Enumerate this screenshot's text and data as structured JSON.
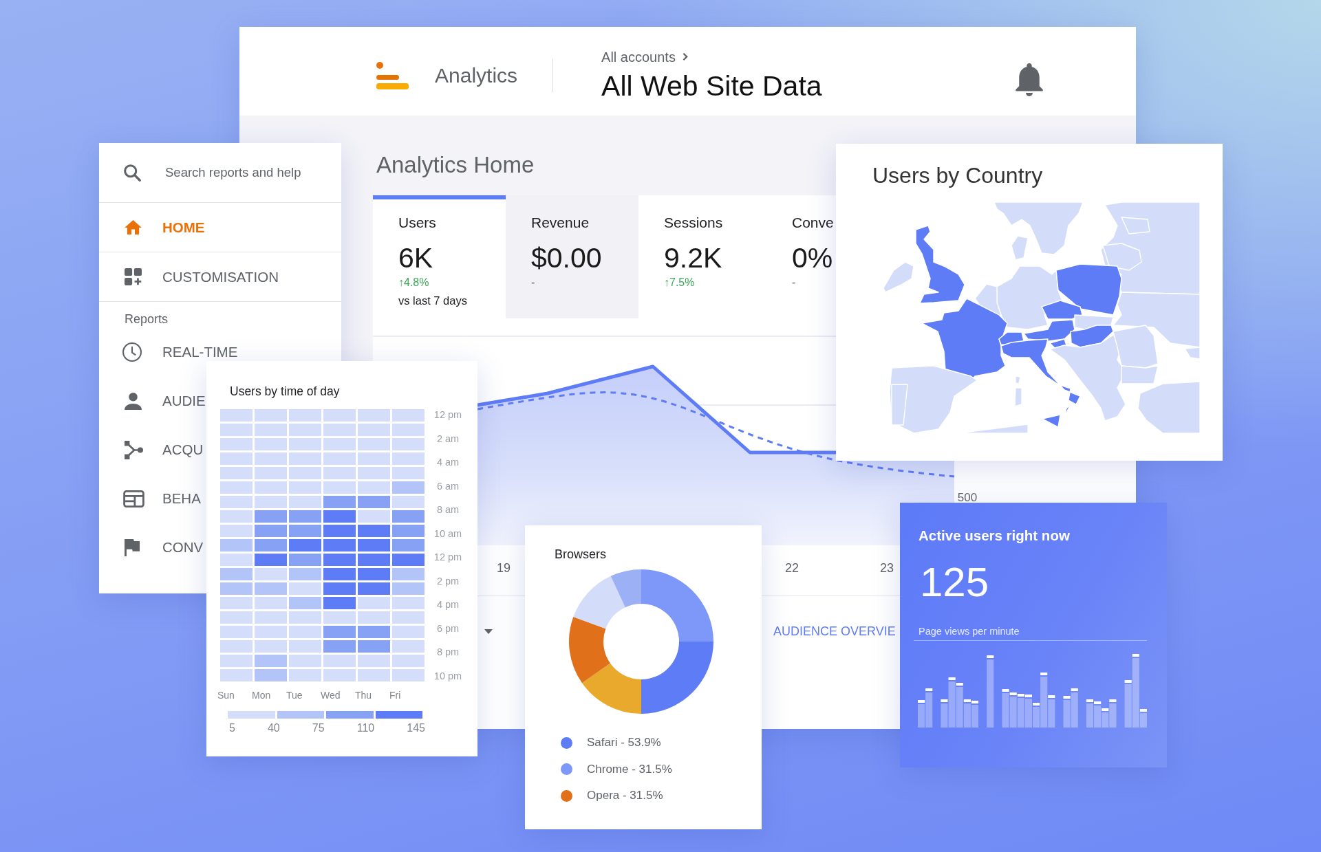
{
  "header": {
    "app_name": "Analytics",
    "breadcrumb": "All accounts",
    "view_title": "All Web Site Data"
  },
  "sidebar": {
    "search": {
      "placeholder": "Search reports and help"
    },
    "items": [
      {
        "label": "HOME",
        "selected": true
      },
      {
        "label": "CUSTOMISATION",
        "selected": false
      }
    ],
    "reports": {
      "title": "Reports",
      "items": [
        {
          "label": "REAL-TIME",
          "selected": false
        },
        {
          "label": "AUDIE",
          "selected": false
        },
        {
          "label": "ACQU",
          "selected": false
        },
        {
          "label": "BEHA",
          "selected": false
        },
        {
          "label": "CONV",
          "selected": false
        }
      ]
    }
  },
  "page_title": "Analytics Home",
  "metrics": [
    {
      "label": "Users",
      "value": "6K",
      "change": "↑4.8%",
      "rising": true,
      "note": "vs last 7 days",
      "selected": true,
      "shaded": false
    },
    {
      "label": "Revenue",
      "value": "$0.00",
      "change": "-",
      "rising": false,
      "selected": false,
      "shaded": true
    },
    {
      "label": "Sessions",
      "value": "9.2K",
      "change": "↑7.5%",
      "rising": true,
      "selected": false,
      "shaded": false
    },
    {
      "label": "Conve",
      "value": "0%",
      "change": "-",
      "rising": false,
      "selected": false,
      "shaded": false
    }
  ],
  "chart": {
    "x_labels": [
      "19",
      "22",
      "23"
    ],
    "y_label": "500"
  },
  "footer": {
    "link": "AUDIENCE OVERVIE"
  },
  "heatmap": {
    "title": "Users by time of day",
    "rows": [
      {
        "cells": [
          {
            "color": "#d4defb"
          },
          {
            "color": "#d4defb"
          },
          {
            "color": "#d4defb"
          },
          {
            "color": "#d4defb"
          },
          {
            "color": "#d4defb"
          },
          {
            "color": "#d4defb"
          }
        ]
      },
      {
        "cells": [
          {
            "color": "#d4defb"
          },
          {
            "color": "#d4defb"
          },
          {
            "color": "#d4defb"
          },
          {
            "color": "#d4defb"
          },
          {
            "color": "#d4defb"
          },
          {
            "color": "#d4defb"
          }
        ]
      },
      {
        "cells": [
          {
            "color": "#d4defb"
          },
          {
            "color": "#d4defb"
          },
          {
            "color": "#d4defb"
          },
          {
            "color": "#d4defb"
          },
          {
            "color": "#d4defb"
          },
          {
            "color": "#d4defb"
          }
        ]
      },
      {
        "cells": [
          {
            "color": "#d4defb"
          },
          {
            "color": "#d4defb"
          },
          {
            "color": "#d4defb"
          },
          {
            "color": "#d4defb"
          },
          {
            "color": "#d4defb"
          },
          {
            "color": "#d4defb"
          }
        ]
      },
      {
        "cells": [
          {
            "color": "#d4defb"
          },
          {
            "color": "#d4defb"
          },
          {
            "color": "#d4defb"
          },
          {
            "color": "#d4defb"
          },
          {
            "color": "#d4defb"
          },
          {
            "color": "#d4defb"
          }
        ]
      },
      {
        "cells": [
          {
            "color": "#d4defb"
          },
          {
            "color": "#d4defb"
          },
          {
            "color": "#d4defb"
          },
          {
            "color": "#d4defb"
          },
          {
            "color": "#d4defb"
          },
          {
            "color": "#b3c4f9"
          }
        ]
      },
      {
        "cells": [
          {
            "color": "#d4defb"
          },
          {
            "color": "#d4defb"
          },
          {
            "color": "#d4defb"
          },
          {
            "color": "#87a1f5"
          },
          {
            "color": "#87a1f5"
          },
          {
            "color": "#d4defb"
          }
        ]
      },
      {
        "cells": [
          {
            "color": "#d4defb"
          },
          {
            "color": "#87a1f5"
          },
          {
            "color": "#87a1f5"
          },
          {
            "color": "#5f7cf7"
          },
          {
            "color": "#d4defb"
          },
          {
            "color": "#87a1f5"
          }
        ]
      },
      {
        "cells": [
          {
            "color": "#d4defb"
          },
          {
            "color": "#87a1f5"
          },
          {
            "color": "#87a1f5"
          },
          {
            "color": "#5f7cf7"
          },
          {
            "color": "#5f7cf7"
          },
          {
            "color": "#87a1f5"
          }
        ]
      },
      {
        "cells": [
          {
            "color": "#b3c4f9"
          },
          {
            "color": "#87a1f5"
          },
          {
            "color": "#5f7cf7"
          },
          {
            "color": "#5f7cf7"
          },
          {
            "color": "#5f7cf7"
          },
          {
            "color": "#87a1f5"
          }
        ]
      },
      {
        "cells": [
          {
            "color": "#d4defb"
          },
          {
            "color": "#5f7cf7"
          },
          {
            "color": "#87a1f5"
          },
          {
            "color": "#5f7cf7"
          },
          {
            "color": "#5f7cf7"
          },
          {
            "color": "#5f7cf7"
          }
        ]
      },
      {
        "cells": [
          {
            "color": "#b3c4f9"
          },
          {
            "color": "#d4defb"
          },
          {
            "color": "#b3c4f9"
          },
          {
            "color": "#5f7cf7"
          },
          {
            "color": "#5f7cf7"
          },
          {
            "color": "#b3c4f9"
          }
        ]
      },
      {
        "cells": [
          {
            "color": "#b3c4f9"
          },
          {
            "color": "#b3c4f9"
          },
          {
            "color": "#d4defb"
          },
          {
            "color": "#5f7cf7"
          },
          {
            "color": "#5f7cf7"
          },
          {
            "color": "#b3c4f9"
          }
        ]
      },
      {
        "cells": [
          {
            "color": "#d4defb"
          },
          {
            "color": "#d4defb"
          },
          {
            "color": "#b3c4f9"
          },
          {
            "color": "#5f7cf7"
          },
          {
            "color": "#d4defb"
          },
          {
            "color": "#d4defb"
          }
        ]
      },
      {
        "cells": [
          {
            "color": "#d4defb"
          },
          {
            "color": "#d4defb"
          },
          {
            "color": "#d4defb"
          },
          {
            "color": "#d4defb"
          },
          {
            "color": "#d4defb"
          },
          {
            "color": "#d4defb"
          }
        ]
      },
      {
        "cells": [
          {
            "color": "#d4defb"
          },
          {
            "color": "#d4defb"
          },
          {
            "color": "#d4defb"
          },
          {
            "color": "#87a1f5"
          },
          {
            "color": "#87a1f5"
          },
          {
            "color": "#d4defb"
          }
        ]
      },
      {
        "cells": [
          {
            "color": "#d4defb"
          },
          {
            "color": "#d4defb"
          },
          {
            "color": "#d4defb"
          },
          {
            "color": "#87a1f5"
          },
          {
            "color": "#87a1f5"
          },
          {
            "color": "#d4defb"
          }
        ]
      },
      {
        "cells": [
          {
            "color": "#d4defb"
          },
          {
            "color": "#b3c4f9"
          },
          {
            "color": "#d4defb"
          },
          {
            "color": "#d4defb"
          },
          {
            "color": "#d4defb"
          },
          {
            "color": "#d4defb"
          }
        ]
      },
      {
        "cells": [
          {
            "color": "#d4defb"
          },
          {
            "color": "#b3c4f9"
          },
          {
            "color": "#d4defb"
          },
          {
            "color": "#d4defb"
          },
          {
            "color": "#d4defb"
          },
          {
            "color": "#d4defb"
          }
        ]
      }
    ],
    "time_labels": [
      "12 pm",
      "2 am",
      "4 am",
      "6 am",
      "8 am",
      "10 am",
      "12 pm",
      "2 pm",
      "4 pm",
      "6 pm",
      "8 pm",
      "10 pm"
    ],
    "days": [
      "Sun",
      "Mon",
      "Tue",
      "Wed",
      "Thu",
      "Fri"
    ],
    "scale": [
      {
        "color": "#d4defb"
      },
      {
        "color": "#b3c4f9"
      },
      {
        "color": "#87a1f5"
      },
      {
        "color": "#5f7cf7"
      }
    ],
    "scale_labels": [
      "5",
      "40",
      "75",
      "110",
      "145"
    ]
  },
  "map": {
    "title": "Users by Country"
  },
  "browsers": {
    "title": "Browsers",
    "legend": [
      {
        "label": "Safari - 53.9%",
        "color": "#5f7cf7"
      },
      {
        "label": "Chrome - 31.5%",
        "color": "#7d98f8"
      },
      {
        "label": "Opera - 31.5%",
        "color": "#e0701a"
      }
    ]
  },
  "active_users": {
    "title": "Active users right now",
    "count": "125",
    "caption": "Page views per minute"
  }
}
